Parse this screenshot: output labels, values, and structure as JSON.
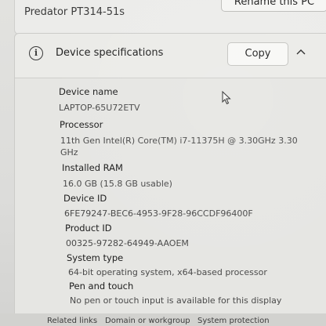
{
  "top_card": {
    "model": "Predator PT314-51s",
    "rename_button": "Rename this PC"
  },
  "device_specs": {
    "title": "Device specifications",
    "copy_button": "Copy",
    "icons": {
      "info": "info-icon",
      "collapse": "chevron-up-icon"
    },
    "fields": [
      {
        "label": "Device name",
        "value": "LAPTOP-65U72ETV"
      },
      {
        "label": "Processor",
        "value": "11th Gen Intel(R) Core(TM) i7-11375H @ 3.30GHz   3.30",
        "value2": "GHz"
      },
      {
        "label": "Installed RAM",
        "value": "16.0 GB (15.8 GB usable)"
      },
      {
        "label": "Device ID",
        "value": "6FE79247-BEC6-4953-9F28-96CCDF96400F"
      },
      {
        "label": "Product ID",
        "value": "00325-97282-64949-AAOEM"
      },
      {
        "label": "System type",
        "value": "64-bit operating system, x64-based processor"
      },
      {
        "label": "Pen and touch",
        "value": "No pen or touch input is available for this display"
      }
    ]
  },
  "related_links": {
    "label": "Related links",
    "links": [
      "Domain or workgroup",
      "System protection"
    ]
  }
}
